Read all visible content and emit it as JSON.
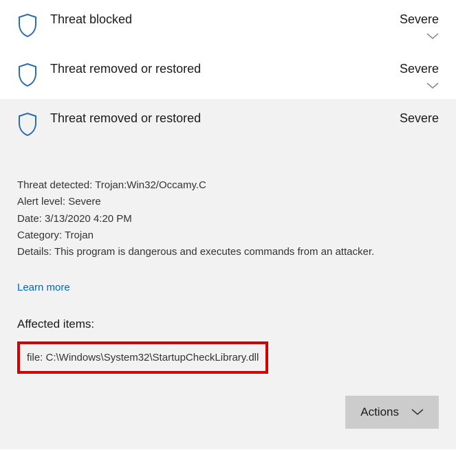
{
  "threats": [
    {
      "title": "Threat blocked",
      "severity": "Severe",
      "expanded": false
    },
    {
      "title": "Threat removed or restored",
      "severity": "Severe",
      "expanded": false
    },
    {
      "title": "Threat removed or restored",
      "severity": "Severe",
      "expanded": true
    }
  ],
  "details": {
    "threat_detected_label": "Threat detected:",
    "threat_detected_value": "Trojan:Win32/Occamy.C",
    "alert_level_label": "Alert level:",
    "alert_level_value": "Severe",
    "date_label": "Date:",
    "date_value": "3/13/2020 4:20 PM",
    "category_label": "Category:",
    "category_value": "Trojan",
    "details_label": "Details:",
    "details_value": "This program is dangerous and executes commands from an attacker."
  },
  "learn_more": "Learn more",
  "affected_heading": "Affected items:",
  "affected_item": "file: C:\\Windows\\System32\\StartupCheckLibrary.dll",
  "actions_button": "Actions"
}
